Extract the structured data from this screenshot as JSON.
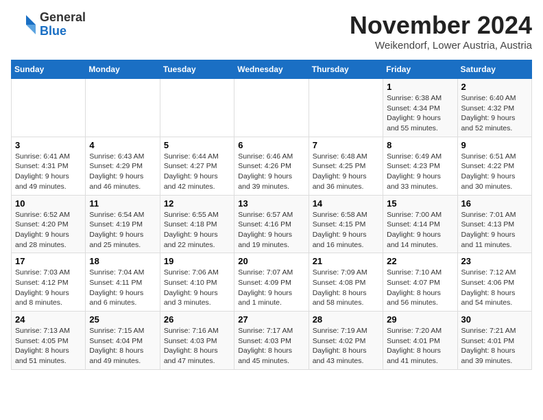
{
  "logo": {
    "general": "General",
    "blue": "Blue"
  },
  "title": "November 2024",
  "location": "Weikendorf, Lower Austria, Austria",
  "days_of_week": [
    "Sunday",
    "Monday",
    "Tuesday",
    "Wednesday",
    "Thursday",
    "Friday",
    "Saturday"
  ],
  "weeks": [
    [
      {
        "day": "",
        "info": ""
      },
      {
        "day": "",
        "info": ""
      },
      {
        "day": "",
        "info": ""
      },
      {
        "day": "",
        "info": ""
      },
      {
        "day": "",
        "info": ""
      },
      {
        "day": "1",
        "info": "Sunrise: 6:38 AM\nSunset: 4:34 PM\nDaylight: 9 hours\nand 55 minutes."
      },
      {
        "day": "2",
        "info": "Sunrise: 6:40 AM\nSunset: 4:32 PM\nDaylight: 9 hours\nand 52 minutes."
      }
    ],
    [
      {
        "day": "3",
        "info": "Sunrise: 6:41 AM\nSunset: 4:31 PM\nDaylight: 9 hours\nand 49 minutes."
      },
      {
        "day": "4",
        "info": "Sunrise: 6:43 AM\nSunset: 4:29 PM\nDaylight: 9 hours\nand 46 minutes."
      },
      {
        "day": "5",
        "info": "Sunrise: 6:44 AM\nSunset: 4:27 PM\nDaylight: 9 hours\nand 42 minutes."
      },
      {
        "day": "6",
        "info": "Sunrise: 6:46 AM\nSunset: 4:26 PM\nDaylight: 9 hours\nand 39 minutes."
      },
      {
        "day": "7",
        "info": "Sunrise: 6:48 AM\nSunset: 4:25 PM\nDaylight: 9 hours\nand 36 minutes."
      },
      {
        "day": "8",
        "info": "Sunrise: 6:49 AM\nSunset: 4:23 PM\nDaylight: 9 hours\nand 33 minutes."
      },
      {
        "day": "9",
        "info": "Sunrise: 6:51 AM\nSunset: 4:22 PM\nDaylight: 9 hours\nand 30 minutes."
      }
    ],
    [
      {
        "day": "10",
        "info": "Sunrise: 6:52 AM\nSunset: 4:20 PM\nDaylight: 9 hours\nand 28 minutes."
      },
      {
        "day": "11",
        "info": "Sunrise: 6:54 AM\nSunset: 4:19 PM\nDaylight: 9 hours\nand 25 minutes."
      },
      {
        "day": "12",
        "info": "Sunrise: 6:55 AM\nSunset: 4:18 PM\nDaylight: 9 hours\nand 22 minutes."
      },
      {
        "day": "13",
        "info": "Sunrise: 6:57 AM\nSunset: 4:16 PM\nDaylight: 9 hours\nand 19 minutes."
      },
      {
        "day": "14",
        "info": "Sunrise: 6:58 AM\nSunset: 4:15 PM\nDaylight: 9 hours\nand 16 minutes."
      },
      {
        "day": "15",
        "info": "Sunrise: 7:00 AM\nSunset: 4:14 PM\nDaylight: 9 hours\nand 14 minutes."
      },
      {
        "day": "16",
        "info": "Sunrise: 7:01 AM\nSunset: 4:13 PM\nDaylight: 9 hours\nand 11 minutes."
      }
    ],
    [
      {
        "day": "17",
        "info": "Sunrise: 7:03 AM\nSunset: 4:12 PM\nDaylight: 9 hours\nand 8 minutes."
      },
      {
        "day": "18",
        "info": "Sunrise: 7:04 AM\nSunset: 4:11 PM\nDaylight: 9 hours\nand 6 minutes."
      },
      {
        "day": "19",
        "info": "Sunrise: 7:06 AM\nSunset: 4:10 PM\nDaylight: 9 hours\nand 3 minutes."
      },
      {
        "day": "20",
        "info": "Sunrise: 7:07 AM\nSunset: 4:09 PM\nDaylight: 9 hours\nand 1 minute."
      },
      {
        "day": "21",
        "info": "Sunrise: 7:09 AM\nSunset: 4:08 PM\nDaylight: 8 hours\nand 58 minutes."
      },
      {
        "day": "22",
        "info": "Sunrise: 7:10 AM\nSunset: 4:07 PM\nDaylight: 8 hours\nand 56 minutes."
      },
      {
        "day": "23",
        "info": "Sunrise: 7:12 AM\nSunset: 4:06 PM\nDaylight: 8 hours\nand 54 minutes."
      }
    ],
    [
      {
        "day": "24",
        "info": "Sunrise: 7:13 AM\nSunset: 4:05 PM\nDaylight: 8 hours\nand 51 minutes."
      },
      {
        "day": "25",
        "info": "Sunrise: 7:15 AM\nSunset: 4:04 PM\nDaylight: 8 hours\nand 49 minutes."
      },
      {
        "day": "26",
        "info": "Sunrise: 7:16 AM\nSunset: 4:03 PM\nDaylight: 8 hours\nand 47 minutes."
      },
      {
        "day": "27",
        "info": "Sunrise: 7:17 AM\nSunset: 4:03 PM\nDaylight: 8 hours\nand 45 minutes."
      },
      {
        "day": "28",
        "info": "Sunrise: 7:19 AM\nSunset: 4:02 PM\nDaylight: 8 hours\nand 43 minutes."
      },
      {
        "day": "29",
        "info": "Sunrise: 7:20 AM\nSunset: 4:01 PM\nDaylight: 8 hours\nand 41 minutes."
      },
      {
        "day": "30",
        "info": "Sunrise: 7:21 AM\nSunset: 4:01 PM\nDaylight: 8 hours\nand 39 minutes."
      }
    ]
  ]
}
